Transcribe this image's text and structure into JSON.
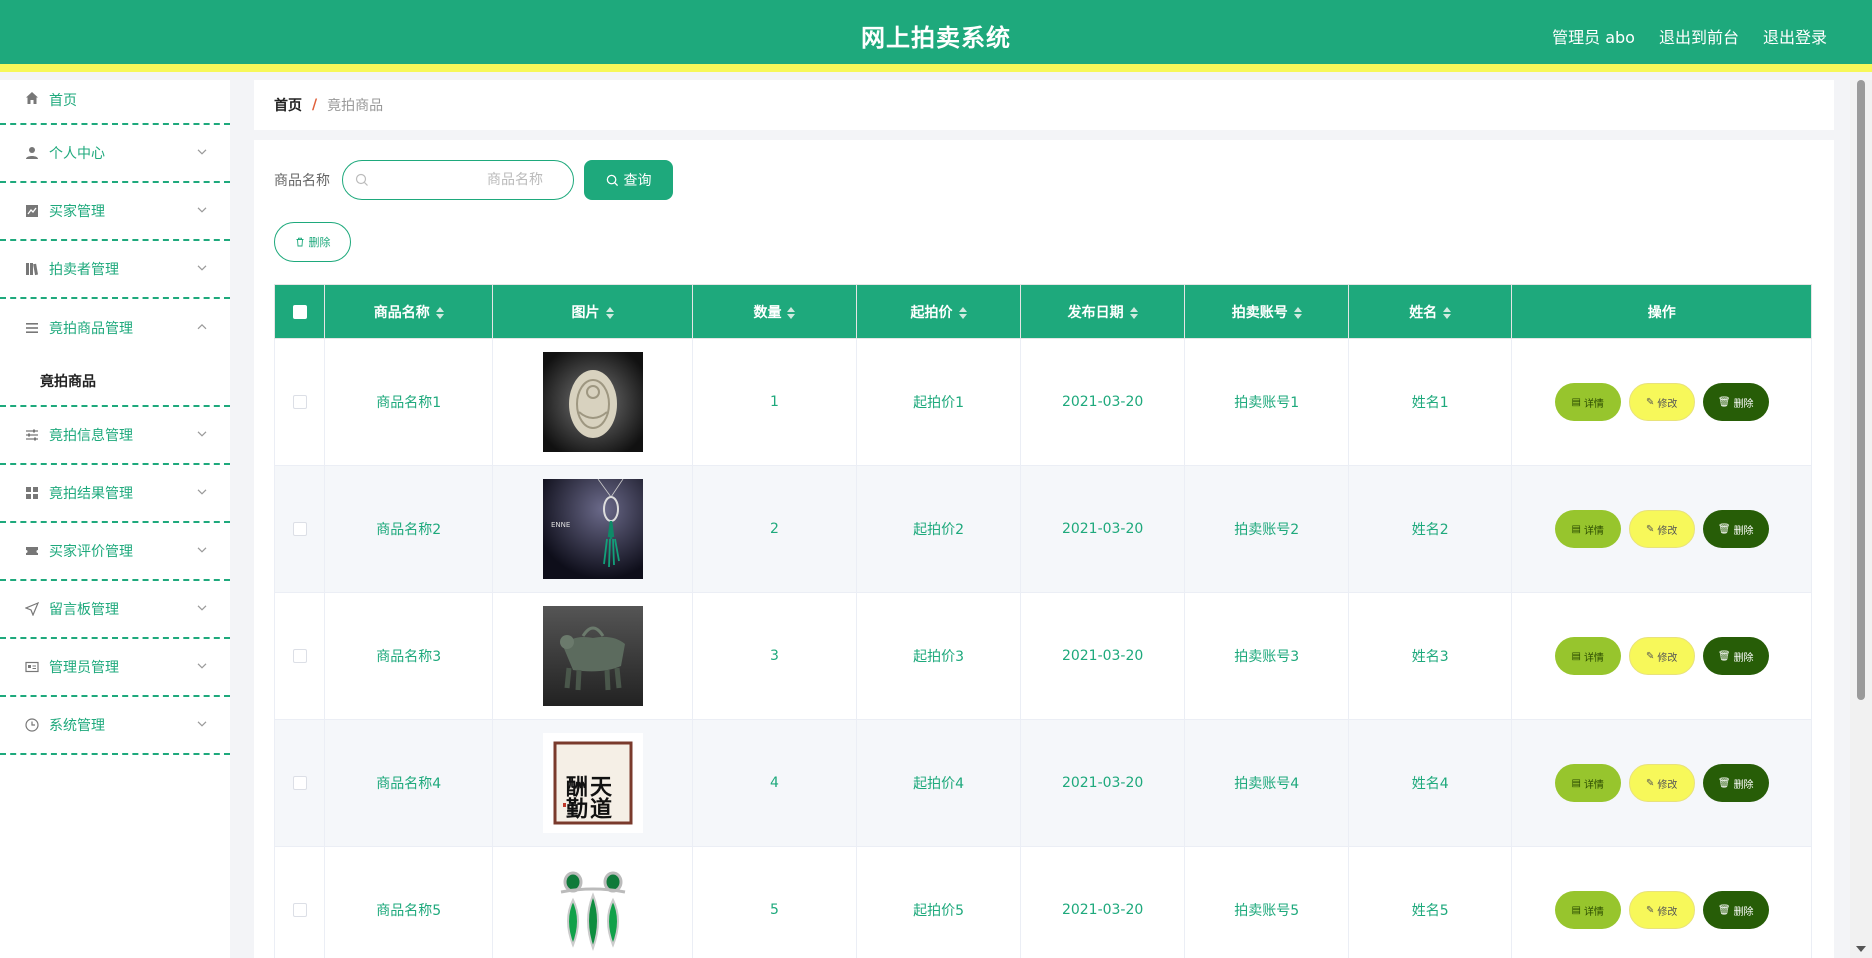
{
  "header": {
    "title": "网上拍卖系统",
    "admin_label": "管理员 abo",
    "to_frontend": "退出到前台",
    "logout": "退出登录"
  },
  "sidebar": {
    "items": [
      {
        "label": "首页",
        "icon": "home-icon",
        "expandable": false
      },
      {
        "label": "个人中心",
        "icon": "user-icon",
        "expandable": true
      },
      {
        "label": "买家管理",
        "icon": "chart-icon",
        "expandable": true
      },
      {
        "label": "拍卖者管理",
        "icon": "books-icon",
        "expandable": true
      },
      {
        "label": "竟拍商品管理",
        "icon": "list-icon",
        "expandable": true,
        "expanded": true,
        "children": [
          "竟拍商品"
        ]
      },
      {
        "label": "竟拍信息管理",
        "icon": "sliders-icon",
        "expandable": true
      },
      {
        "label": "竟拍结果管理",
        "icon": "grid-icon",
        "expandable": true
      },
      {
        "label": "买家评价管理",
        "icon": "ticket-icon",
        "expandable": true
      },
      {
        "label": "留言板管理",
        "icon": "send-icon",
        "expandable": true
      },
      {
        "label": "管理员管理",
        "icon": "card-icon",
        "expandable": true
      },
      {
        "label": "系统管理",
        "icon": "clock-icon",
        "expandable": true
      }
    ]
  },
  "breadcrumb": {
    "home": "首页",
    "separator": "/",
    "current": "竟拍商品"
  },
  "search": {
    "label": "商品名称",
    "placeholder": "商品名称",
    "button": "查询"
  },
  "actions": {
    "delete": "删除"
  },
  "table": {
    "columns": [
      "商品名称",
      "图片",
      "数量",
      "起拍价",
      "发布日期",
      "拍卖账号",
      "姓名",
      "操作"
    ],
    "rows": [
      {
        "name": "商品名称1",
        "image": "jade-carving",
        "qty": "1",
        "price": "起拍价1",
        "date": "2021-03-20",
        "account": "拍卖账号1",
        "person": "姓名1"
      },
      {
        "name": "商品名称2",
        "image": "jade-pendant",
        "qty": "2",
        "price": "起拍价2",
        "date": "2021-03-20",
        "account": "拍卖账号2",
        "person": "姓名2"
      },
      {
        "name": "商品名称3",
        "image": "bronze-vessel",
        "qty": "3",
        "price": "起拍价3",
        "date": "2021-03-20",
        "account": "拍卖账号3",
        "person": "姓名3"
      },
      {
        "name": "商品名称4",
        "image": "calligraphy",
        "qty": "4",
        "price": "起拍价4",
        "date": "2021-03-20",
        "account": "拍卖账号4",
        "person": "姓名4"
      },
      {
        "name": "商品名称5",
        "image": "emerald-earrings",
        "qty": "5",
        "price": "起拍价5",
        "date": "2021-03-20",
        "account": "拍卖账号5",
        "person": "姓名5"
      }
    ],
    "row_actions": {
      "detail": "详情",
      "edit": "修改",
      "delete": "删除"
    }
  },
  "calligraphy_text": [
    "天道",
    "酬勤"
  ],
  "colors": {
    "primary": "#1ea97c",
    "accent_yellow": "#f7f85a",
    "detail": "#97c52d",
    "delete": "#275d07"
  }
}
